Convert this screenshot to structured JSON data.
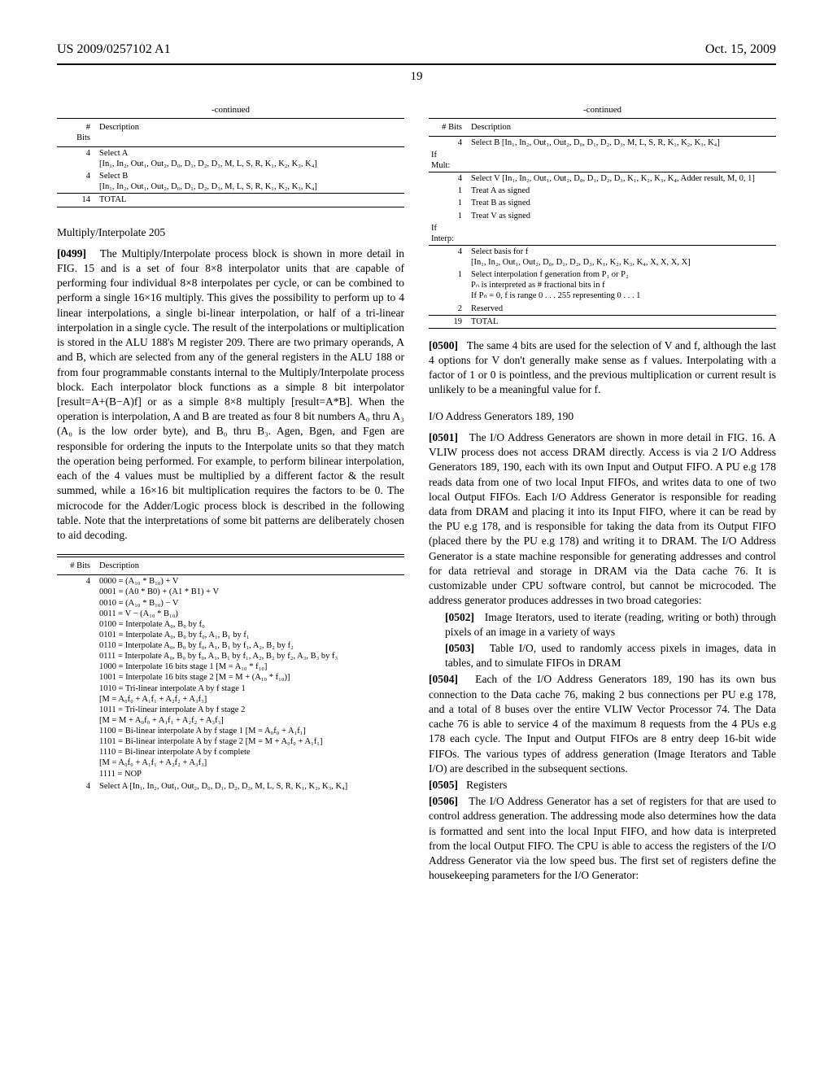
{
  "header": {
    "left": "US 2009/0257102 A1",
    "right": "Oct. 15, 2009"
  },
  "page_number": "19",
  "continued": "-continued",
  "col1": {
    "table1": {
      "h1": "#",
      "h2": "Bits",
      "h3": "Description",
      "rows": [
        {
          "bits": "4",
          "desc": "Select A\n[In₁, In₂, Out₁, Out₂, D₀, D₁, D₂, D₃, M, L, S, R, K₁, K₂, K₃, K₄]"
        },
        {
          "bits": "4",
          "desc": "Select B\n[In₁, In₂, Out₁, Out₂, D₀, D₁, D₂, D₃, M, L, S, R, K₁, K₂, K₃, K₄]"
        }
      ],
      "total": {
        "bits": "14",
        "desc": "TOTAL"
      }
    },
    "sec1_title": "Multiply/Interpolate 205",
    "para1_num": "[0499]",
    "para1": "The Multiply/Interpolate process block is shown in more detail in FIG. 15 and is a set of four 8×8 interpolator units that are capable of performing four individual 8×8 interpolates per cycle, or can be combined to perform a single 16×16 multiply. This gives the possibility to perform up to 4 linear interpolations, a single bi-linear interpolation, or half of a tri-linear interpolation in a single cycle. The result of the interpolations or multiplication is stored in the ALU 188's M register 209. There are two primary operands, A and B, which are selected from any of the general registers in the ALU 188 or from four programmable constants internal to the Multiply/Interpolate process block. Each interpolator block functions as a simple 8 bit interpolator [result=A+(B−A)f] or as a simple 8×8 multiply [result=A*B]. When the operation is interpolation, A and B are treated as four 8 bit numbers A₀ thru A₃ (A₀ is the low order byte), and B₀ thru B₃. Agen, Bgen, and Fgen are responsible for ordering the inputs to the Interpolate units so that they match the operation being performed. For example, to perform bilinear interpolation, each of the 4 values must be multiplied by a different factor & the result summed, while a 16×16 bit multiplication requires the factors to be 0. The microcode for the Adder/Logic process block is described in the following table. Note that the interpretations of some bit patterns are deliberately chosen to aid decoding.",
    "table2": {
      "h1": "# Bits",
      "h2": "Description",
      "r4bits": "4",
      "r4lines": [
        "0000 = (A₁₀ * B₁₀) + V",
        "0001 = (A0 * B0) + (A1 * B1) + V",
        "0010 = (A₁₀ * B₁₀) − V",
        "0011 = V − (A₁₀ * B₁₀)",
        "0100 = Interpolate A₀, B₀ by f₀",
        "0101 = Interpolate A₀, B₀ by f₀, A₁, B₁ by f₁",
        "0110 = Interpolate A₀, B₀ by f₀, A₁, B₁ by f₁, A₂, B₂ by f₂",
        "0111 = Interpolate A₀, B₀ by f₀, A₁, B₁ by f₁, A₂, B₂ by f₂, A₃, B₃ by f₃",
        "1000 = Interpolate 16 bits stage 1 [M = A₁₀ * f₁₀]",
        "1001 = Interpolate 16 bits stage 2 [M = M + (A₁₀ * f₁₀)]",
        "1010 = Tri-linear interpolate A by f stage 1",
        "[M = A₀f₀ + A₁f₁ + A₂f₂ + A₃f₃]",
        "1011 = Tri-linear interpolate A by f stage 2",
        "[M = M + A₀f₀ + A₁f₁ + A₂f₂ + A₃f₃]",
        "1100 = Bi-linear interpolate A by f stage 1 [M = A₀f₀ + A₁f₁]",
        "1101 = Bi-linear interpolate A by f stage 2 [M = M + A₀f₀ + A₁f₁]",
        "1110 = Bi-linear interpolate A by f complete",
        "[M = A₀f₀ + A₁f₁ + A₂f₂ + A₃f₃]",
        "1111 = NOP"
      ],
      "rSelA": {
        "bits": "4",
        "desc": "Select A [In₁, In₂, Out₁, Out₂, D₀, D₁, D₂, D₃, M, L, S, R, K₁, K₂, K₃, K₄]"
      }
    }
  },
  "col2": {
    "table3": {
      "h1": "# Bits",
      "h2": "Description",
      "rows": [
        {
          "bits": "4",
          "desc": "Select B [In₁, In₂, Out₁, Out₂, D₀, D₁, D₂, D₃, M, L, S, R, K₁, K₂, K₃, K₄]"
        }
      ],
      "ifmult": "If\nMult:",
      "rows2": [
        {
          "bits": "4",
          "desc": "Select V [In₁, In₂, Out₁, Out₂, D₀, D₁, D₂, D₃, K₁, K₂, K₃, K₄, Adder result, M, 0, 1]"
        },
        {
          "bits": "1",
          "desc": "Treat A as signed"
        },
        {
          "bits": "1",
          "desc": "Treat B as signed"
        },
        {
          "bits": "1",
          "desc": "Treat V as signed"
        }
      ],
      "ifinterp": "If\nInterp:",
      "rows3": [
        {
          "bits": "4",
          "desc": "Select basis for f\n[In₁, In₂, Out₁, Out₂, D₀, D₁, D₂, D₃, K₁, K₂, K₃, K₄, X, X, X, X]"
        },
        {
          "bits": "1",
          "desc": "Select interpolation f generation from P₁ or P₂\nPₙ is interpreted as # fractional bits in f\nIf Pₙ = 0, f is range 0 . . . 255 representing 0 . . . 1"
        },
        {
          "bits": "2",
          "desc": "Reserved"
        }
      ],
      "total": {
        "bits": "19",
        "desc": "TOTAL"
      }
    },
    "para2_num": "[0500]",
    "para2": "The same 4 bits are used for the selection of V and f, although the last 4 options for V don't generally make sense as f values. Interpolating with a factor of 1 or 0 is pointless, and the previous multiplication or current result is unlikely to be a meaningful value for f.",
    "sec2_title": "I/O Address Generators 189, 190",
    "para3_num": "[0501]",
    "para3": "The I/O Address Generators are shown in more detail in FIG. 16. A VLIW process does not access DRAM directly. Access is via 2 I/O Address Generators 189, 190, each with its own Input and Output FIFO. A PU e.g 178 reads data from one of two local Input FIFOs, and writes data to one of two local Output FIFOs. Each I/O Address Generator is responsible for reading data from DRAM and placing it into its Input FIFO, where it can be read by the PU e.g 178, and is responsible for taking the data from its Output FIFO (placed there by the PU e.g 178) and writing it to DRAM. The I/O Address Generator is a state machine responsible for generating addresses and control for data retrieval and storage in DRAM via the Data cache 76. It is customizable under CPU software control, but cannot be microcoded. The address generator produces addresses in two broad categories:",
    "para4_num": "[0502]",
    "para4": "Image Iterators, used to iterate (reading, writing or both) through pixels of an image in a variety of ways",
    "para5_num": "[0503]",
    "para5": "Table I/O, used to randomly access pixels in images, data in tables, and to simulate FIFOs in DRAM",
    "para6_num": "[0504]",
    "para6": "Each of the I/O Address Generators 189, 190 has its own bus connection to the Data cache 76, making 2 bus connections per PU e.g 178, and a total of 8 buses over the entire VLIW Vector Processor 74. The Data cache 76 is able to service 4 of the maximum 8 requests from the 4 PUs e.g 178 each cycle. The Input and Output FIFOs are 8 entry deep 16-bit wide FIFOs. The various types of address generation (Image Iterators and Table I/O) are described in the subsequent sections.",
    "para7_num": "[0505]",
    "para7": "Registers",
    "para8_num": "[0506]",
    "para8": "The I/O Address Generator has a set of registers for that are used to control address generation. The addressing mode also determines how the data is formatted and sent into the local Input FIFO, and how data is interpreted from the local Output FIFO. The CPU is able to access the registers of the I/O Address Generator via the low speed bus. The first set of registers define the housekeeping parameters for the I/O Generator:"
  }
}
